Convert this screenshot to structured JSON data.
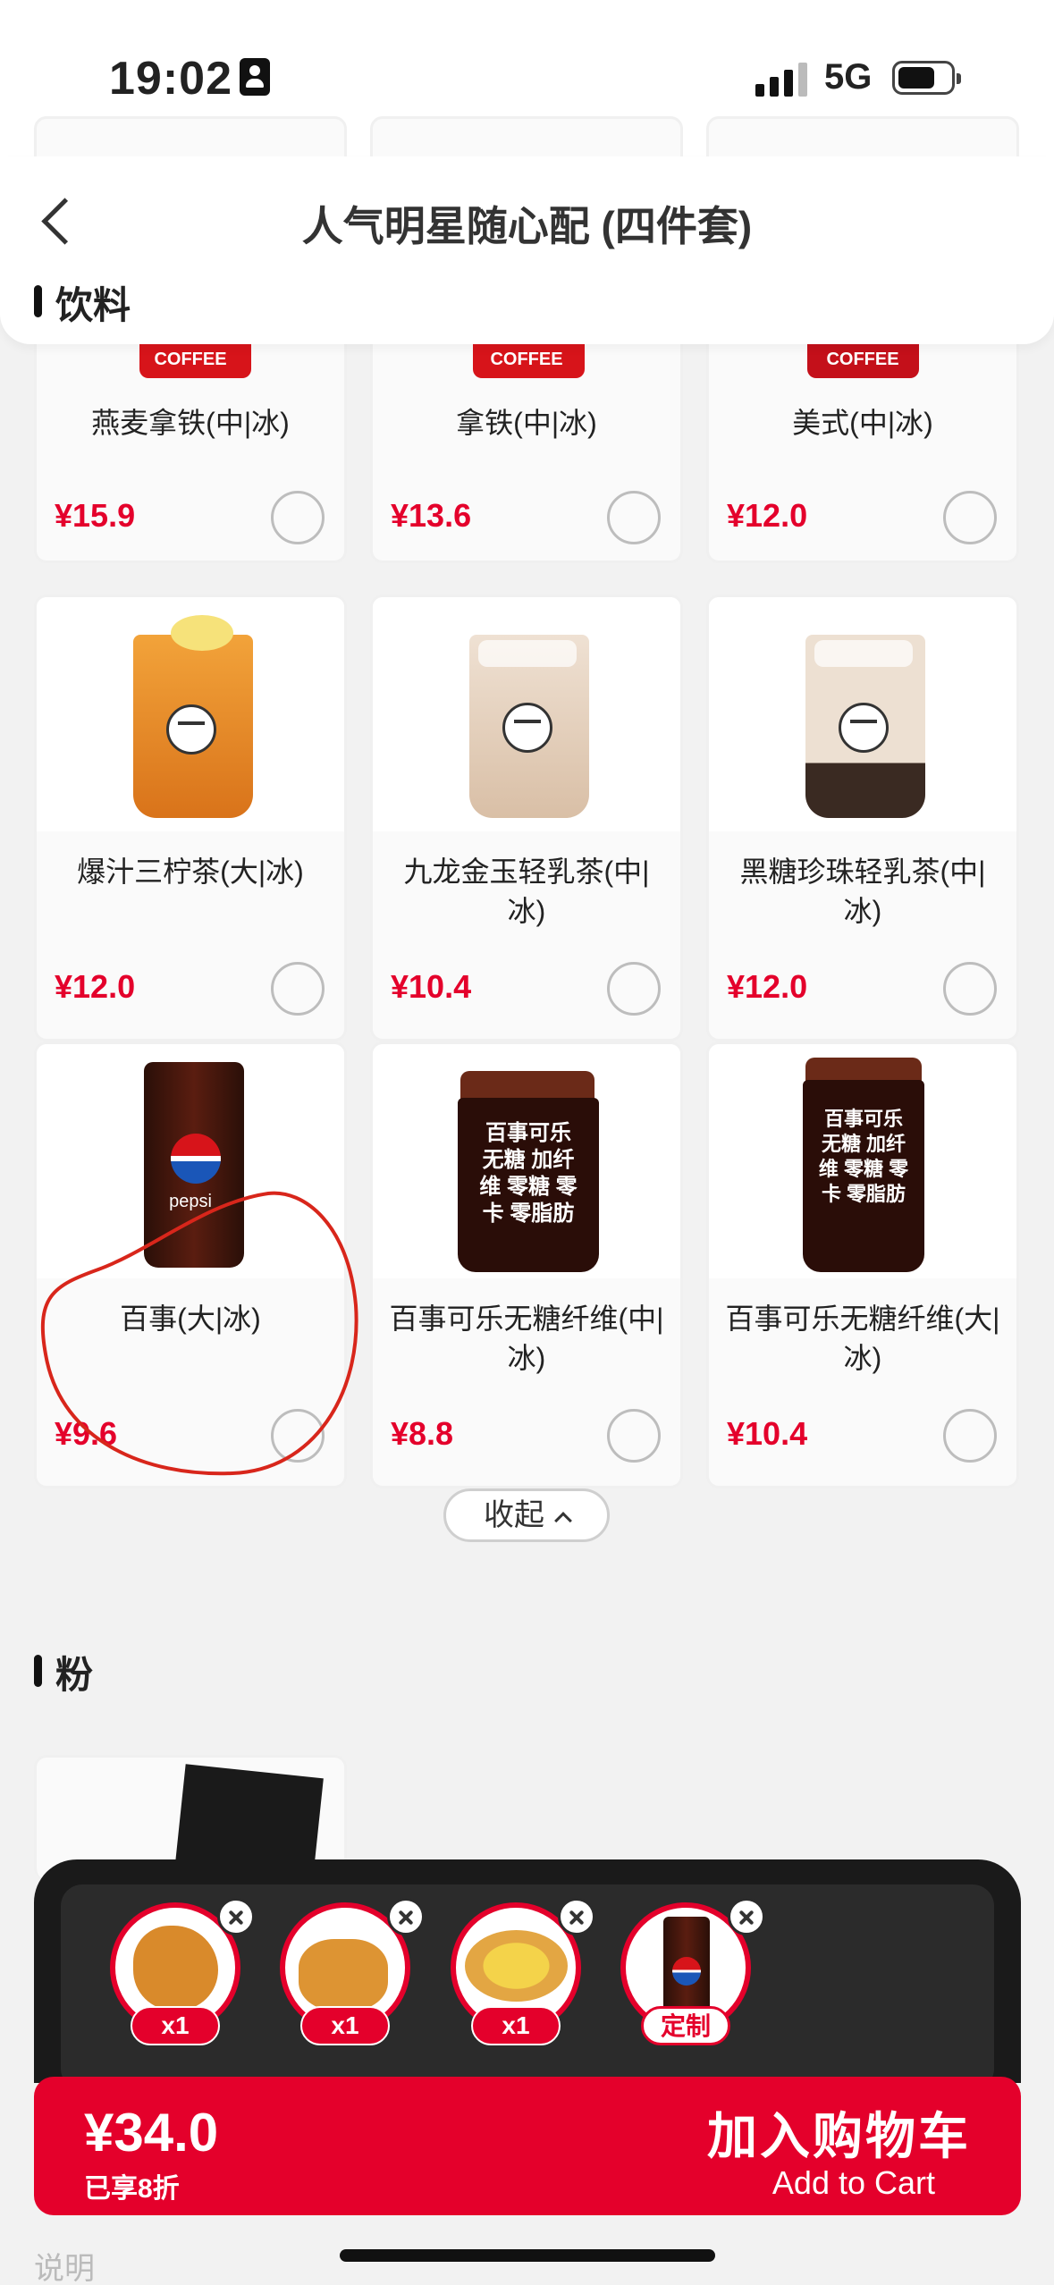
{
  "status_bar": {
    "time": "19:02",
    "network": "5G"
  },
  "header": {
    "title": "人气明星随心配 (四件套)"
  },
  "sections": {
    "drinks": {
      "title": "饮料"
    },
    "noodles": {
      "title": "粉"
    }
  },
  "products": [
    {
      "name": "燕麦拿铁(中|冰)",
      "price": "¥15.9",
      "image_text": "COFFEE"
    },
    {
      "name": "拿铁(中|冰)",
      "price": "¥13.6",
      "image_text": "COFFEE"
    },
    {
      "name": "美式(中|冰)",
      "price": "¥12.0",
      "image_text": "COFFEE"
    },
    {
      "name": "爆汁三柠茶(大|冰)",
      "price": "¥12.0"
    },
    {
      "name": "九龙金玉轻乳茶(中|冰)",
      "price": "¥10.4"
    },
    {
      "name": "黑糖珍珠轻乳茶(中|冰)",
      "price": "¥12.0"
    },
    {
      "name": "百事(大|冰)",
      "price": "¥9.6",
      "image_text": "pepsi"
    },
    {
      "name": "百事可乐无糖纤维(中|冰)",
      "price": "¥8.8",
      "image_text": "百事可乐无糖 加纤维 零糖 零卡 零脂肪"
    },
    {
      "name": "百事可乐无糖纤维(大|冰)",
      "price": "¥10.4",
      "image_text": "百事可乐无糖 加纤维 零糖 零卡 零脂肪"
    }
  ],
  "collapse_button": {
    "label": "收起"
  },
  "tray": {
    "items": [
      {
        "badge": "x1",
        "icon": "fried-chicken-icon"
      },
      {
        "badge": "x1",
        "icon": "popcorn-chicken-icon"
      },
      {
        "badge": "x1",
        "icon": "egg-tart-icon"
      },
      {
        "badge": "定制",
        "icon": "pepsi-cup-icon"
      }
    ]
  },
  "cart": {
    "price": "¥34.0",
    "discount": "已享8折",
    "cta_cn": "加入购物车",
    "cta_en": "Add to Cart"
  },
  "footer": {
    "note": "说明"
  },
  "colors": {
    "accent": "#e4002b",
    "tray_bg": "#1a1a1a"
  }
}
